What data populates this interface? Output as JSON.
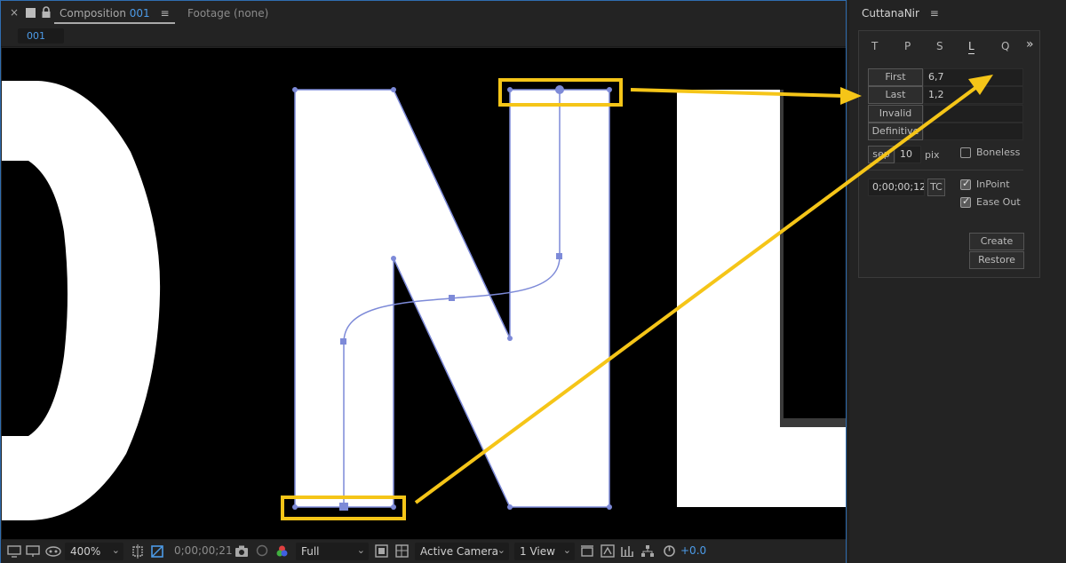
{
  "comp_panel": {
    "close_glyph": "×",
    "tab_label": "Composition",
    "tab_number": "001",
    "menu_glyph": "≡",
    "footage_tab": "Footage (none)",
    "subtab": "001"
  },
  "viewer_bar": {
    "zoom": "400%",
    "timecode": "0;00;00;21",
    "resolution": "Full",
    "camera": "Active Camera",
    "views": "1 View",
    "exposure": "+0.0"
  },
  "script_panel": {
    "title": "CuttanaNir",
    "menu_glyph": "≡",
    "tabs": [
      "T",
      "P",
      "S",
      "L",
      "Q"
    ],
    "active_tab": "L",
    "more_glyph": "»",
    "buttons": {
      "first": "First",
      "last": "Last",
      "invalid": "Invalid",
      "definitive": "Definitive",
      "sep": "sep",
      "tc": "TC",
      "create": "Create",
      "restore": "Restore"
    },
    "fields": {
      "first": "6,7",
      "last": "1,2",
      "invalid": "",
      "definitive": "",
      "sep_value": "10",
      "timecode": "0;00;00;12"
    },
    "unit": "pix",
    "checkboxes": {
      "boneless": {
        "label": "Boneless",
        "checked": false
      },
      "inpoint": {
        "label": "InPoint",
        "checked": true
      },
      "ease_out": {
        "label": "Ease Out",
        "checked": true
      }
    }
  },
  "colors": {
    "accent_blue": "#4c9be8",
    "path_color": "#7d8ad8",
    "highlight_yellow": "#f5c518"
  }
}
